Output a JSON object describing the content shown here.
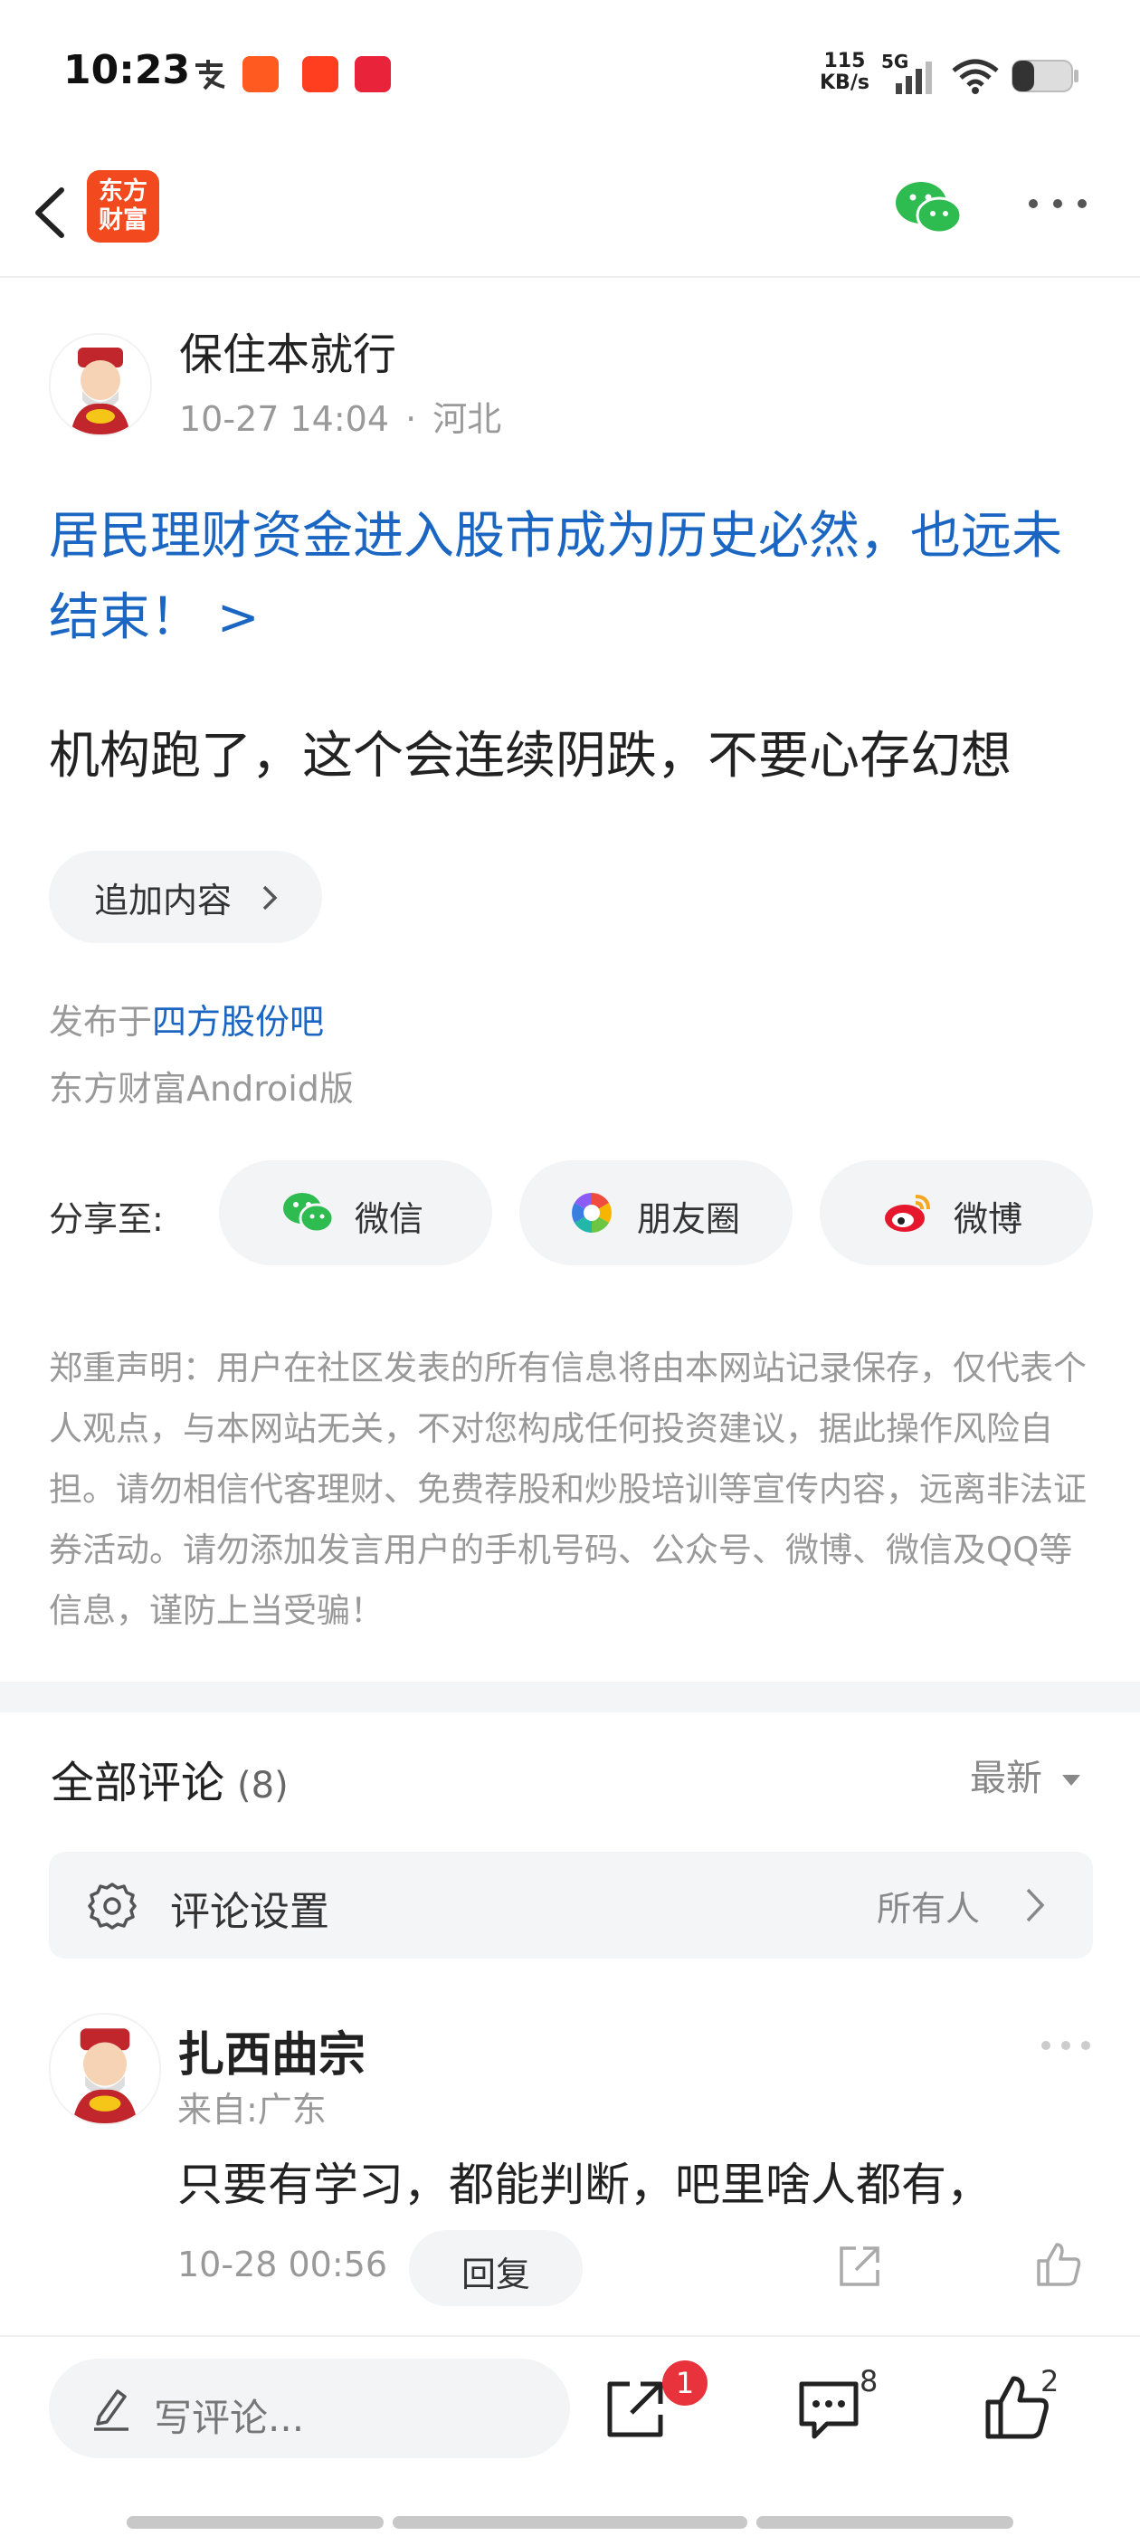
{
  "status_bar": {
    "time": "10:23",
    "speed": "115",
    "speed_unit": "KB/s",
    "network": "5G",
    "icons": [
      "alipay-icon",
      "fund-app-icon",
      "taobao-icon",
      "tmall-icon",
      "signal-icon",
      "wifi-icon",
      "battery-icon"
    ]
  },
  "nav": {
    "logo_line1": "东方",
    "logo_line2": "财富"
  },
  "post": {
    "author": "保住本就行",
    "timestamp": "10-27 14:04",
    "location": "河北",
    "meta_separator": "·",
    "title": "居民理财资金进入股市成为历史必然，也远未结束！ >",
    "body": "机构跑了，这个会连续阴跌，不要心存幻想",
    "append_label": "追加内容",
    "published_prefix": "发布于",
    "published_forum": "四方股份吧",
    "platform": "东方财富Android版"
  },
  "share": {
    "label": "分享至:",
    "options": [
      {
        "label": "微信",
        "icon": "wechat-icon"
      },
      {
        "label": "朋友圈",
        "icon": "moments-icon"
      },
      {
        "label": "微博",
        "icon": "weibo-icon"
      }
    ]
  },
  "disclaimer": "郑重声明：用户在社区发表的所有信息将由本网站记录保存，仅代表个人观点，与本网站无关，不对您构成任何投资建议，据此操作风险自担。请勿相信代客理财、免费荐股和炒股培训等宣传内容，远离非法证券活动。请勿添加发言用户的手机号码、公众号、微博、微信及QQ等信息，谨防上当受骗！",
  "comments": {
    "title": "全部评论",
    "count": "(8)",
    "sort": "最新",
    "settings_label": "评论设置",
    "settings_value": "所有人",
    "items": [
      {
        "name": "扎西曲宗",
        "from": "来自:广东",
        "text": "只要有学习，都能判断，吧里啥人都有，",
        "time": "10-28 00:56",
        "reply_label": "回复"
      }
    ]
  },
  "bottom_bar": {
    "placeholder": "写评论...",
    "share_badge": "1",
    "comment_count": "8",
    "like_count": "2"
  },
  "colors": {
    "accent_blue": "#1a66c2",
    "brand_orange": "#f24a1e",
    "badge_red": "#e8323c"
  }
}
